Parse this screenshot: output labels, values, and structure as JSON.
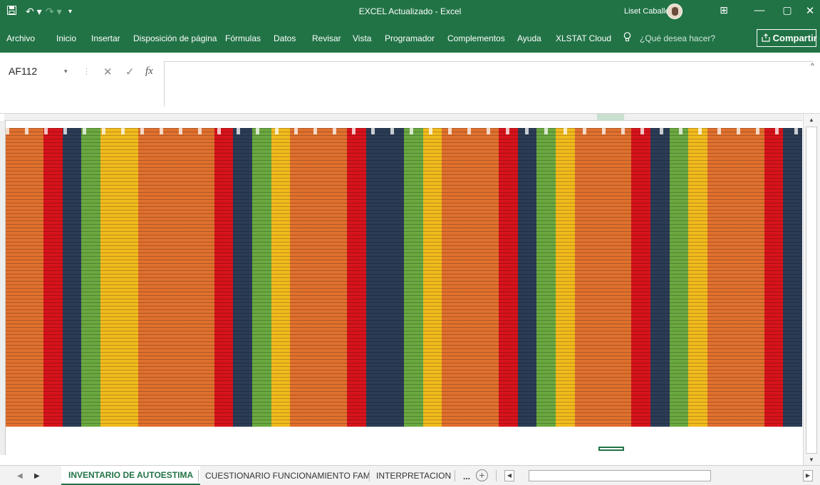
{
  "window": {
    "title": "EXCEL Actualizado - Excel",
    "user": "Liset Caballero",
    "icons": [
      "save-icon",
      "undo-icon",
      "redo-icon",
      "customize-icon",
      "ribbon-display-icon",
      "minimize-icon",
      "restore-icon",
      "close-icon"
    ],
    "controls": {
      "undo": "↶ ▾",
      "redo": "↷ ▾",
      "customize": "▾",
      "ribbon_display": "⊞",
      "minimize": "—",
      "restore": "▢",
      "close": "✕"
    }
  },
  "ribbon": {
    "tabs": [
      "Archivo",
      "Inicio",
      "Insertar",
      "Disposición de página",
      "Fórmulas",
      "Datos",
      "Revisar",
      "Vista",
      "Programador",
      "Complementos",
      "Ayuda",
      "XLSTAT Cloud"
    ],
    "search_placeholder": "¿Qué desea hacer?",
    "share_label": "Compartir"
  },
  "formula_bar": {
    "name_box": "AF112",
    "cancel_symbol": "✕",
    "enter_symbol": "✓",
    "function_symbol": "fx",
    "value": ""
  },
  "grid": {
    "colors": {
      "orange": "#e0702e",
      "red": "#d7131b",
      "navy": "#2b3c55",
      "green": "#6aa840",
      "yellow": "#f1ba1d"
    },
    "column_bands": [
      "orange",
      "orange",
      "red",
      "navy",
      "green",
      "yellow",
      "yellow",
      "orange",
      "orange",
      "orange",
      "orange",
      "red",
      "navy",
      "green",
      "yellow",
      "orange",
      "orange",
      "orange",
      "red",
      "navy",
      "navy",
      "green",
      "yellow",
      "orange",
      "orange",
      "orange",
      "red",
      "navy",
      "green",
      "yellow",
      "orange",
      "orange",
      "orange",
      "red",
      "navy",
      "green",
      "yellow",
      "orange",
      "orange",
      "orange",
      "red",
      "navy"
    ],
    "selected_cell": "AF112"
  },
  "sheets": {
    "tabs": [
      "INVENTARIO DE AUTOESTIMA",
      "CUESTIONARIO FUNCIONAMIENTO FAM",
      "INTERPRETACION"
    ],
    "active_index": 0,
    "more_label": "...",
    "add_label": "+"
  }
}
